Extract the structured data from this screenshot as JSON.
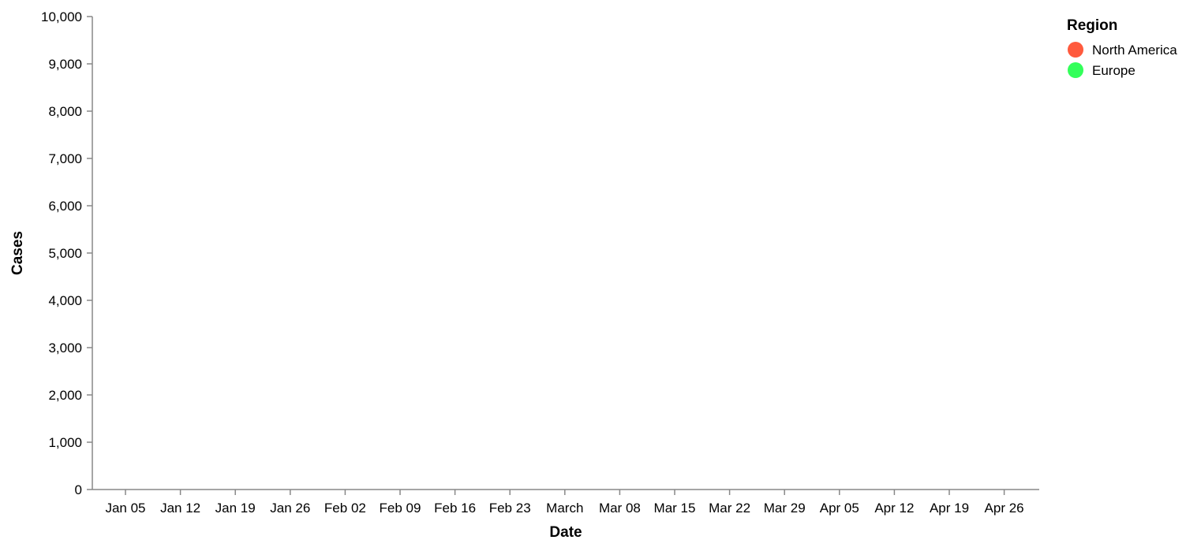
{
  "chart_data": {
    "type": "line",
    "title": "",
    "xlabel": "Date",
    "ylabel": "Cases",
    "x_ticks": [
      "Jan 05",
      "Jan 12",
      "Jan 19",
      "Jan 26",
      "Feb 02",
      "Feb 09",
      "Feb 16",
      "Feb 23",
      "March",
      "Mar 08",
      "Mar 15",
      "Mar 22",
      "Mar 29",
      "Apr 05",
      "Apr 12",
      "Apr 19",
      "Apr 26"
    ],
    "y_ticks": [
      "0",
      "1,000",
      "2,000",
      "3,000",
      "4,000",
      "5,000",
      "6,000",
      "7,000",
      "8,000",
      "9,000",
      "10,000"
    ],
    "ylim": [
      0,
      10000
    ],
    "grid": false,
    "legend": {
      "title": "Region",
      "placement": "top-right"
    },
    "series": [
      {
        "name": "North America",
        "color": "#ff5a3d",
        "points": []
      },
      {
        "name": "Europe",
        "color": "#33ff5a",
        "points": []
      }
    ]
  }
}
